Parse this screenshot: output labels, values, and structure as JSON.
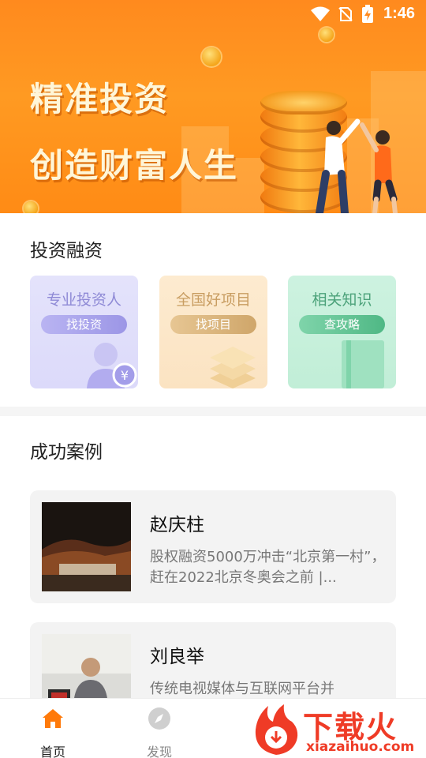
{
  "status_bar": {
    "time": "1:46"
  },
  "banner": {
    "line1": "精准投资",
    "line2": "创造财富人生"
  },
  "invest_section": {
    "title": "投资融资",
    "cards": [
      {
        "title": "专业投资人",
        "button": "找投资",
        "color": "#9c96e6"
      },
      {
        "title": "全国好项目",
        "button": "找项目",
        "color": "#cfa66a"
      },
      {
        "title": "相关知识",
        "button": "查攻略",
        "color": "#4fb885"
      }
    ]
  },
  "cases_section": {
    "title": "成功案例",
    "items": [
      {
        "name": "赵庆柱",
        "desc": "股权融资5000万冲击“北京第一村”，赶在2022北京冬奥会之前 |..."
      },
      {
        "name": "刘良举",
        "desc": "传统电视媒体与互联网平台并"
      }
    ]
  },
  "bottom_nav": {
    "items": [
      {
        "label": "首页",
        "icon": "home-icon",
        "active": true
      },
      {
        "label": "发现",
        "icon": "compass-icon",
        "active": false
      }
    ],
    "active_color": "#ff7a0a"
  },
  "watermark": {
    "brand": "下载火",
    "url": "xiazaihuo.com"
  }
}
